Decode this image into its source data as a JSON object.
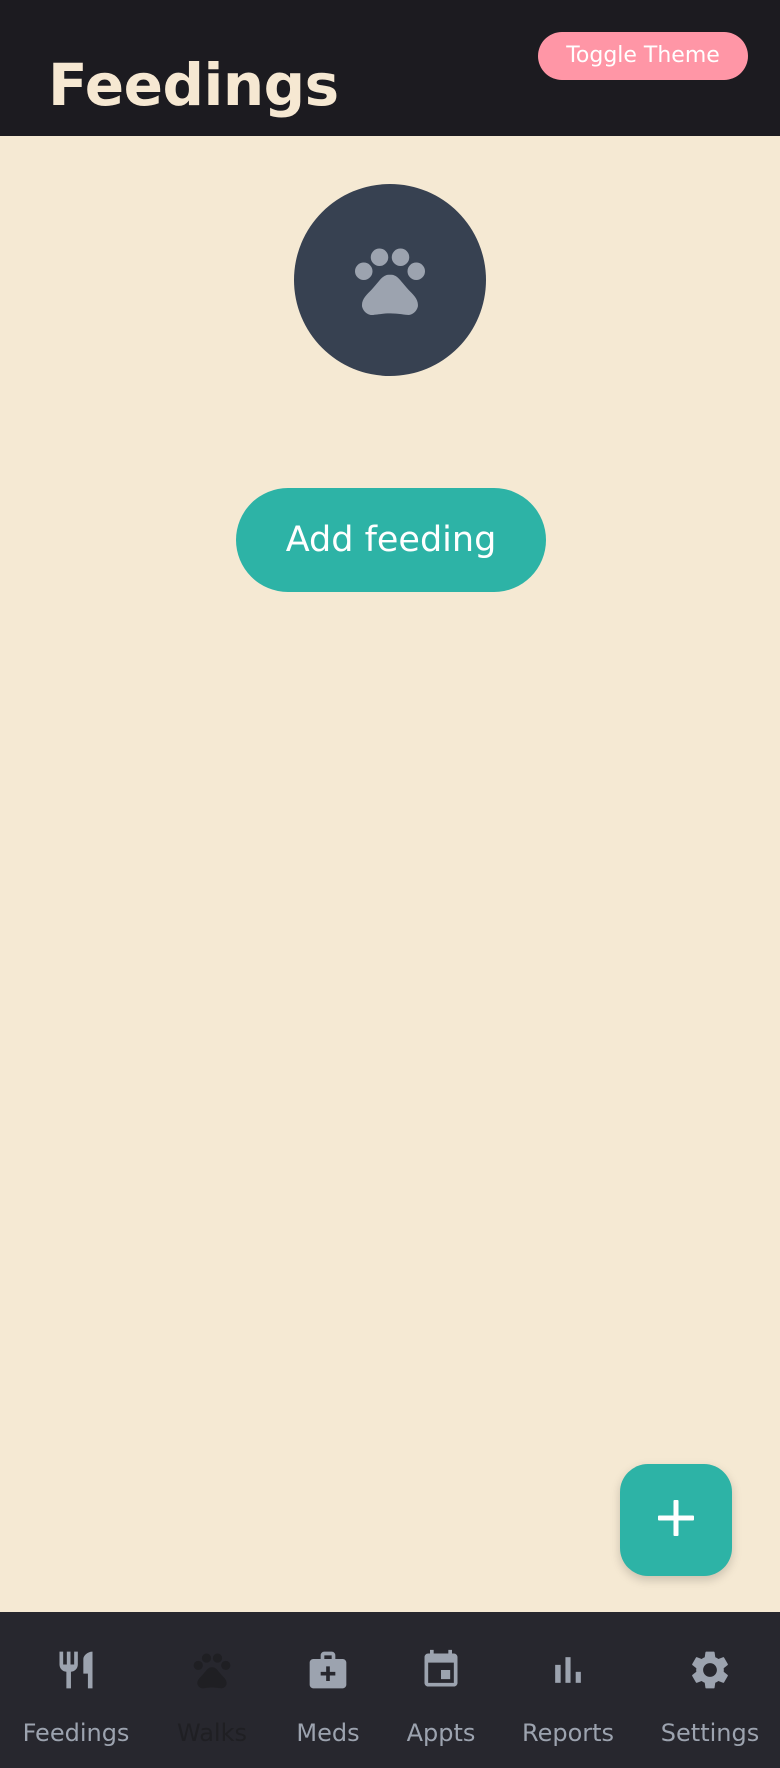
{
  "header": {
    "title": "Feedings",
    "toggle_theme_label": "Toggle Theme"
  },
  "main": {
    "empty_state_icon": "paw-icon",
    "add_button_label": "Add feeding"
  },
  "fab": {
    "icon": "plus-icon"
  },
  "bottom_nav": {
    "items": [
      {
        "label": "Feedings",
        "icon": "fork-knife-icon"
      },
      {
        "label": "Walks",
        "icon": "paw-icon",
        "active": true
      },
      {
        "label": "Meds",
        "icon": "medical-bag-icon"
      },
      {
        "label": "Appts",
        "icon": "calendar-icon"
      },
      {
        "label": "Reports",
        "icon": "bar-chart-icon"
      },
      {
        "label": "Settings",
        "icon": "gear-icon"
      }
    ]
  },
  "colors": {
    "header_bg": "#1c1b20",
    "page_bg": "#f5e9d3",
    "accent": "#2db3a6",
    "toggle_bg": "#ff96a6",
    "nav_bg": "#27272e",
    "avatar_bg": "#374151",
    "icon_muted": "#9ca3af"
  }
}
